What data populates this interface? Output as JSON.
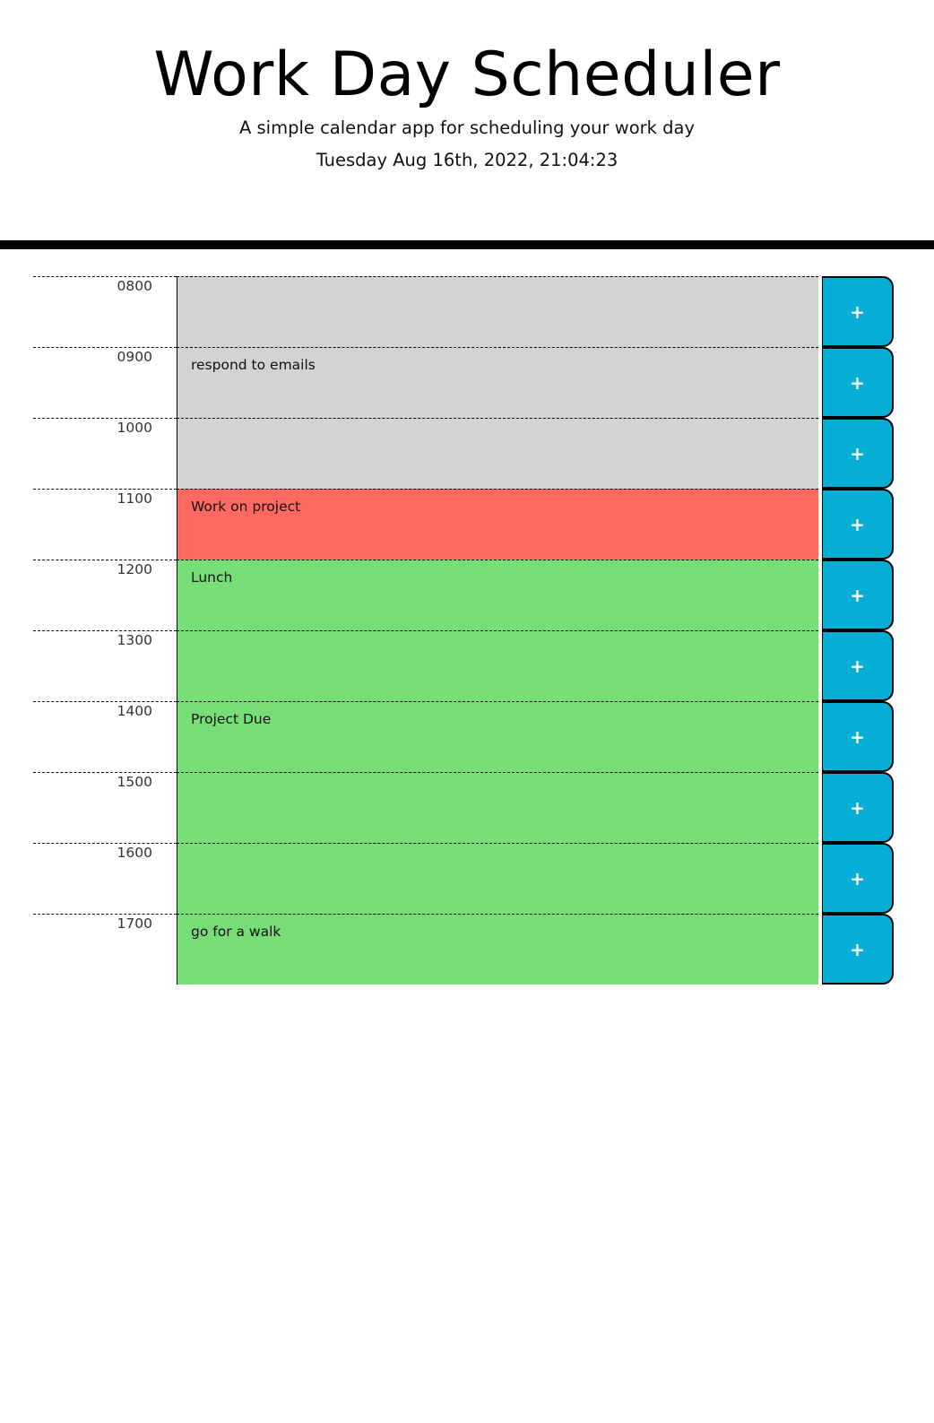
{
  "header": {
    "title": "Work Day Scheduler",
    "subtitle": "A simple calendar app for scheduling your work day",
    "current_day": "Tuesday Aug 16th, 2022, 21:04:23"
  },
  "colors": {
    "past": "#d3d3d3",
    "present": "#ff6961",
    "future": "#77dd77",
    "save_button": "#06aed5"
  },
  "rows": [
    {
      "hour": "0800",
      "text": "",
      "state": "past",
      "save_icon": "+"
    },
    {
      "hour": "0900",
      "text": "respond to emails",
      "state": "past",
      "save_icon": "+"
    },
    {
      "hour": "1000",
      "text": "",
      "state": "past",
      "save_icon": "+"
    },
    {
      "hour": "1100",
      "text": "Work on project",
      "state": "present",
      "save_icon": "+"
    },
    {
      "hour": "1200",
      "text": "Lunch",
      "state": "future",
      "save_icon": "+"
    },
    {
      "hour": "1300",
      "text": "",
      "state": "future",
      "save_icon": "+"
    },
    {
      "hour": "1400",
      "text": "Project Due",
      "state": "future",
      "save_icon": "+"
    },
    {
      "hour": "1500",
      "text": "",
      "state": "future",
      "save_icon": "+"
    },
    {
      "hour": "1600",
      "text": "",
      "state": "future",
      "save_icon": "+"
    },
    {
      "hour": "1700",
      "text": "go for a walk",
      "state": "future",
      "save_icon": "+"
    }
  ]
}
